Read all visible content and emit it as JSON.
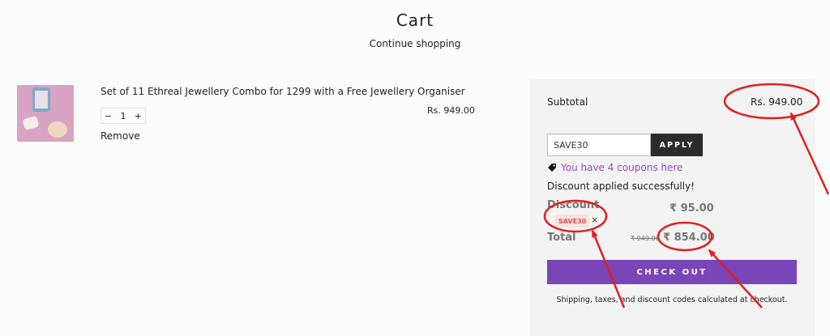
{
  "page": {
    "title": "Cart",
    "continue_link": "Continue shopping"
  },
  "item": {
    "title": "Set of 11 Ethreal Jewellery Combo for 1299 with a Free Jewellery Organiser",
    "price": "Rs. 949.00",
    "quantity": "1",
    "minus": "−",
    "plus": "+",
    "remove": "Remove"
  },
  "summary": {
    "subtotal_label": "Subtotal",
    "subtotal_value": "Rs. 949.00",
    "coupon_value": "SAVE30",
    "apply_label": "APPLY",
    "coupons_text": "You have 4 coupons here",
    "success_text": "Discount applied successfully!",
    "discount_label": "Discount",
    "discount_value": "₹ 95.00",
    "coupon_chip": "SAVE30",
    "chip_remove": "×",
    "total_label": "Total",
    "total_old": "₹ 949.00",
    "total_new": "₹ 854.00",
    "checkout_label": "CHECK OUT",
    "shipping_note": "Shipping, taxes, and discount codes calculated at checkout."
  },
  "colors": {
    "accent": "#7a45b7",
    "annotation": "#e02020",
    "coupon_link": "#8a4fbf"
  }
}
